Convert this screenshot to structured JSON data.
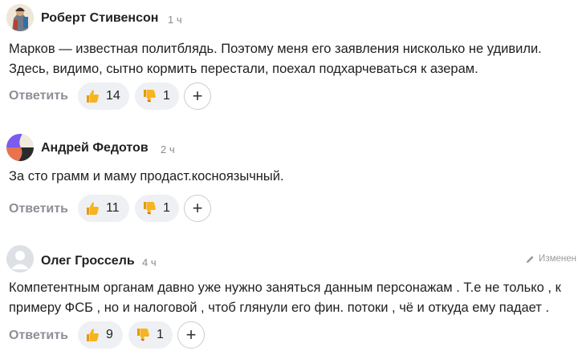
{
  "comments": [
    {
      "author": "Роберт Стивенсон",
      "time": "1 ч",
      "text_lines": [
        "Марков — известная политблядь. Поэтому меня его заявления нисколько не удивили.",
        "Здесь, видимо, сытно кормить перестали, поехал подхарчеваться к азерам."
      ],
      "reply_label": "Ответить",
      "likes": "14",
      "dislikes": "1",
      "edited": ""
    },
    {
      "author": "Андрей Федотов",
      "time": "2 ч",
      "text_lines": [
        "За сто грамм и маму продаст.косноязычный."
      ],
      "reply_label": "Ответить",
      "likes": "11",
      "dislikes": "1",
      "edited": ""
    },
    {
      "author": "Олег Гроссель",
      "time": "4 ч",
      "text_lines": [
        "Компетентным органам давно уже нужно заняться данным персонажам . Т.е не только , к",
        "примеру ФСБ , но и налоговой , чтоб глянули его фин. потоки , чё и откуда ему падает ."
      ],
      "reply_label": "Ответить",
      "likes": "9",
      "dislikes": "1",
      "edited": "Изменен"
    }
  ],
  "icons": {
    "like": "thumbs-up-icon",
    "dislike": "thumbs-down-icon",
    "add_reaction": "plus-icon",
    "edited": "pencil-icon"
  },
  "colors": {
    "pill_bg": "#eef0f3",
    "reply_text": "#8b8f96",
    "emoji_yellow": "#f6b51e"
  }
}
